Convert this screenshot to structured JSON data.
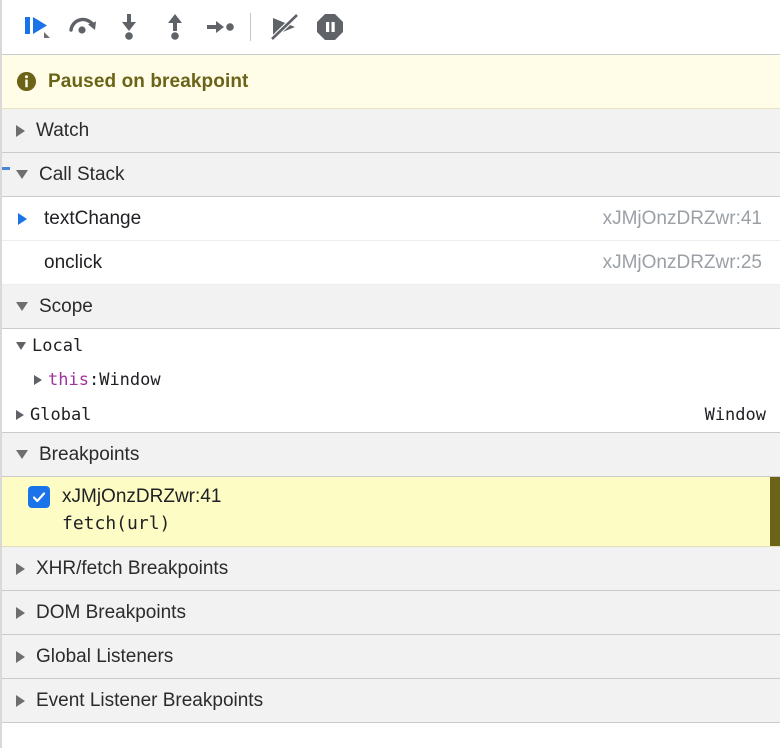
{
  "toolbar": {
    "buttons": [
      {
        "name": "resume-script-execution-button",
        "icon": "resume-icon",
        "active": true
      },
      {
        "name": "step-over-button",
        "icon": "step-over-icon",
        "active": false
      },
      {
        "name": "step-into-button",
        "icon": "step-into-icon",
        "active": false
      },
      {
        "name": "step-out-button",
        "icon": "step-out-icon",
        "active": false
      },
      {
        "name": "step-button",
        "icon": "step-icon",
        "active": false
      },
      {
        "name": "deactivate-breakpoints-button",
        "icon": "deactivate-breakpoints-icon",
        "active": false
      },
      {
        "name": "pause-on-exceptions-button",
        "icon": "pause-octagon-icon",
        "active": false
      }
    ],
    "accent_color": "#1a73e8",
    "icon_color": "#5f6368"
  },
  "banner": {
    "icon": "info-icon",
    "text": "Paused on breakpoint",
    "background": "#fffde7",
    "text_color": "#6b6317"
  },
  "sections": {
    "watch": {
      "label": "Watch",
      "expanded": false
    },
    "call_stack": {
      "label": "Call Stack",
      "expanded": true
    },
    "scope": {
      "label": "Scope",
      "expanded": true
    },
    "breakpoints": {
      "label": "Breakpoints",
      "expanded": true
    },
    "xhr_fetch_breakpoints": {
      "label": "XHR/fetch Breakpoints",
      "expanded": false
    },
    "dom_breakpoints": {
      "label": "DOM Breakpoints",
      "expanded": false
    },
    "global_listeners": {
      "label": "Global Listeners",
      "expanded": false
    },
    "event_listener_breakpoints": {
      "label": "Event Listener Breakpoints",
      "expanded": false
    }
  },
  "call_stack": {
    "frames": [
      {
        "name": "textChange",
        "location": "xJMjOnzDRZwr:41",
        "selected": true
      },
      {
        "name": "onclick",
        "location": "xJMjOnzDRZwr:25",
        "selected": false
      }
    ]
  },
  "scope": {
    "rows": [
      {
        "label": "Local",
        "expanded": true,
        "value": ""
      },
      {
        "keyword": "this",
        "separator": ": ",
        "value": "Window",
        "expanded": false
      },
      {
        "label": "Global",
        "expanded": false,
        "value": "Window"
      }
    ]
  },
  "breakpoints": {
    "items": [
      {
        "checked": true,
        "location": "xJMjOnzDRZwr:41",
        "code": "fetch(url)",
        "highlight_background": "#fdfcc5",
        "scrollbar_color": "#6b6317"
      }
    ]
  }
}
